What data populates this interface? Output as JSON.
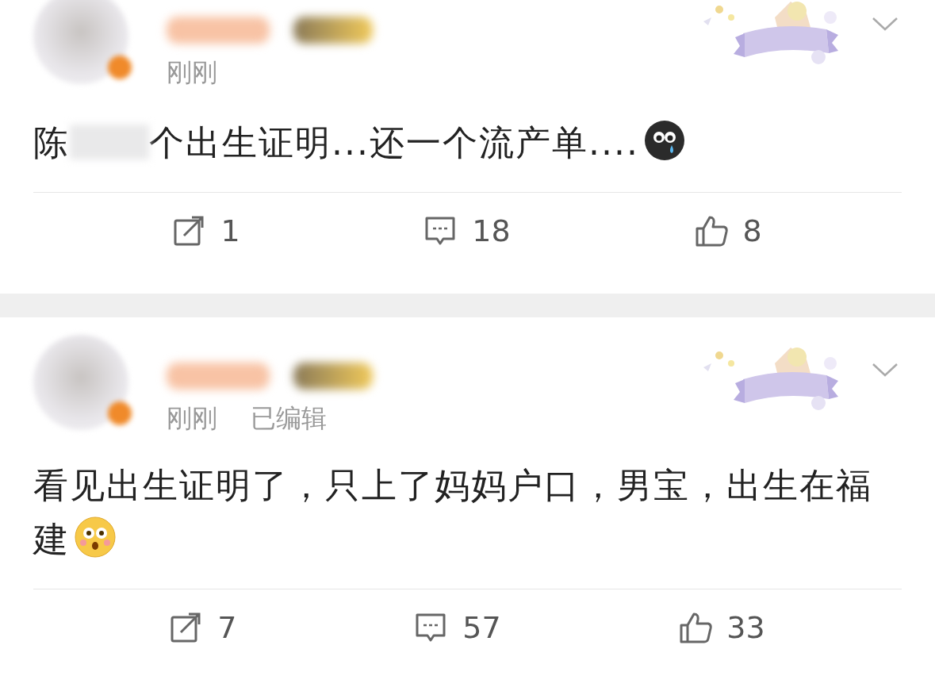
{
  "posts": [
    {
      "time": "刚刚",
      "body": [
        {
          "kind": "text",
          "text": "陈"
        },
        {
          "kind": "redacted"
        },
        {
          "kind": "text",
          "text": "个出生证明...还一个流产单...."
        },
        {
          "kind": "sad-emoji"
        }
      ],
      "actions": {
        "reposts": "1",
        "comments": "18",
        "likes": "8"
      }
    },
    {
      "time": "刚刚",
      "edited": "已编辑",
      "body": [
        {
          "kind": "text",
          "text": "看见出生证明了，只上了妈妈户口，男宝，出生在福建"
        },
        {
          "kind": "shocked-emoji"
        }
      ],
      "actions": {
        "reposts": "7",
        "comments": "57",
        "likes": "33"
      }
    }
  ]
}
